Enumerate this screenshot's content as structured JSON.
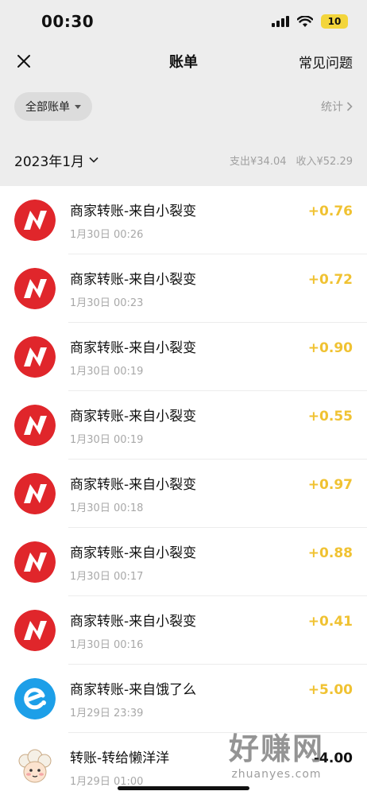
{
  "status_bar": {
    "time": "00:30",
    "battery": "10"
  },
  "nav": {
    "title": "账单",
    "faq": "常见问题"
  },
  "filter": {
    "label": "全部账单",
    "stats": "统计"
  },
  "month": {
    "label": "2023年1月",
    "expense": "支出¥34.04",
    "income": "收入¥52.29"
  },
  "transactions": [
    {
      "title": "商家转账-来自小裂变",
      "date": "1月30日 00:26",
      "amount": "+0.76",
      "icon": "lightning-logo-icon"
    },
    {
      "title": "商家转账-来自小裂变",
      "date": "1月30日 00:23",
      "amount": "+0.72",
      "icon": "lightning-logo-icon"
    },
    {
      "title": "商家转账-来自小裂变",
      "date": "1月30日 00:19",
      "amount": "+0.90",
      "icon": "lightning-logo-icon"
    },
    {
      "title": "商家转账-来自小裂变",
      "date": "1月30日 00:19",
      "amount": "+0.55",
      "icon": "lightning-logo-icon"
    },
    {
      "title": "商家转账-来自小裂变",
      "date": "1月30日 00:18",
      "amount": "+0.97",
      "icon": "lightning-logo-icon"
    },
    {
      "title": "商家转账-来自小裂变",
      "date": "1月30日 00:17",
      "amount": "+0.88",
      "icon": "lightning-logo-icon"
    },
    {
      "title": "商家转账-来自小裂变",
      "date": "1月30日 00:16",
      "amount": "+0.41",
      "icon": "lightning-logo-icon"
    },
    {
      "title": "商家转账-来自饿了么",
      "date": "1月29日 23:39",
      "amount": "+5.00",
      "icon": "eleme-logo-icon"
    },
    {
      "title": "转账-转给懒洋洋",
      "date": "1月29日 01:00",
      "amount": "-4.00",
      "icon": "sheep-avatar-icon"
    }
  ],
  "watermark": {
    "main": "好赚网",
    "sub": "zhuanyes.com"
  },
  "colors": {
    "income": "#f0c232",
    "brand_red": "#e0262b",
    "eleme_blue": "#1d9fe8",
    "background": "#ededed"
  }
}
